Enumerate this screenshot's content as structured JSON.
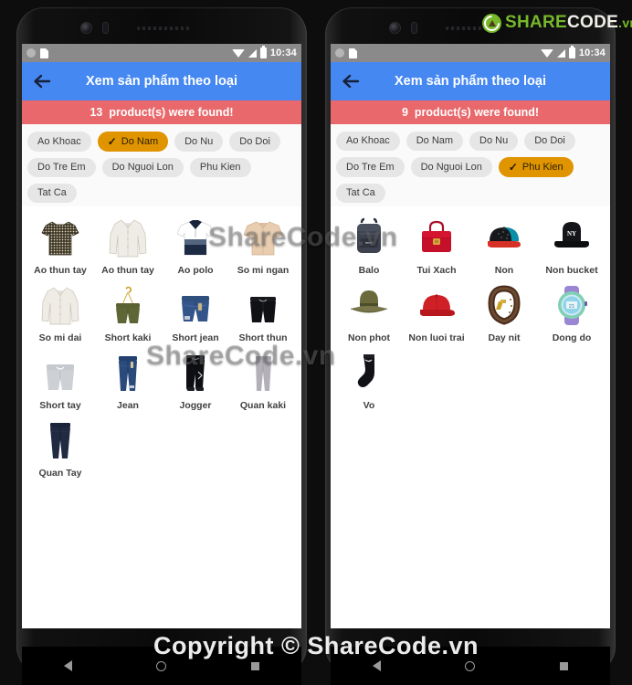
{
  "watermark": {
    "overlay_1": "ShareCode.vn",
    "overlay_2": "ShareCode.vn",
    "bottom": "Copyright © ShareCode.vn",
    "logo_share": "SHARE",
    "logo_code": "CODE",
    "logo_vn": ".vn"
  },
  "colors": {
    "appbar": "#4688f1",
    "banner": "#e9686b",
    "chip_bg": "#e6e6e6",
    "chip_selected": "#e09400",
    "statusbar": "#8a8a8a",
    "brand_green": "#76b82a"
  },
  "phones": [
    {
      "status_bar": {
        "time": "10:34",
        "icons": [
          "circle-icon",
          "sd-card-icon",
          "wifi-icon",
          "signal-icon",
          "battery-icon"
        ]
      },
      "appbar": {
        "title": "Xem sản phẩm theo loại",
        "back_icon": "back-arrow-icon"
      },
      "banner": {
        "count": "13",
        "text": "product(s) were found!"
      },
      "chips": [
        {
          "label": "Ao Khoac",
          "selected": false
        },
        {
          "label": "Do Nam",
          "selected": true
        },
        {
          "label": "Do Nu",
          "selected": false
        },
        {
          "label": "Do Doi",
          "selected": false
        },
        {
          "label": "Do Tre Em",
          "selected": false
        },
        {
          "label": "Do Nguoi Lon",
          "selected": false
        },
        {
          "label": "Phu Kien",
          "selected": false
        },
        {
          "label": "Tat Ca",
          "selected": false
        }
      ],
      "products": [
        {
          "label": "Ao thun tay",
          "icon": "tshirt-patterned"
        },
        {
          "label": "Ao thun tay",
          "icon": "shirt-long-white"
        },
        {
          "label": "Ao polo",
          "icon": "polo-navy"
        },
        {
          "label": "So mi ngan",
          "icon": "shirt-short-beige"
        },
        {
          "label": "So mi dai",
          "icon": "shirt-long-white"
        },
        {
          "label": "Short kaki",
          "icon": "shorts-olive"
        },
        {
          "label": "Short jean",
          "icon": "shorts-denim"
        },
        {
          "label": "Short thun",
          "icon": "shorts-black"
        },
        {
          "label": "Short tay",
          "icon": "shorts-grey"
        },
        {
          "label": "Jean",
          "icon": "jeans-blue"
        },
        {
          "label": "Jogger",
          "icon": "jogger-black"
        },
        {
          "label": "Quan kaki",
          "icon": "pants-grey"
        },
        {
          "label": "Quan Tay",
          "icon": "pants-navy"
        }
      ],
      "nav": {
        "back": "nav-back-icon",
        "home": "nav-home-icon",
        "recents": "nav-recents-icon"
      }
    },
    {
      "status_bar": {
        "time": "10:34",
        "icons": [
          "circle-icon",
          "sd-card-icon",
          "wifi-icon",
          "signal-icon",
          "battery-icon"
        ]
      },
      "appbar": {
        "title": "Xem sản phẩm theo loại",
        "back_icon": "back-arrow-icon"
      },
      "banner": {
        "count": "9",
        "text": "product(s) were found!"
      },
      "chips": [
        {
          "label": "Ao Khoac",
          "selected": false
        },
        {
          "label": "Do Nam",
          "selected": false
        },
        {
          "label": "Do Nu",
          "selected": false
        },
        {
          "label": "Do Doi",
          "selected": false
        },
        {
          "label": "Do Tre Em",
          "selected": false
        },
        {
          "label": "Do Nguoi Lon",
          "selected": false
        },
        {
          "label": "Phu Kien",
          "selected": true
        },
        {
          "label": "Tat Ca",
          "selected": false
        }
      ],
      "products": [
        {
          "label": "Balo",
          "icon": "backpack-grey"
        },
        {
          "label": "Tui Xach",
          "icon": "handbag-red"
        },
        {
          "label": "Non",
          "icon": "snapback-cap"
        },
        {
          "label": "Non bucket",
          "icon": "bucket-hat-black"
        },
        {
          "label": "Non phot",
          "icon": "fedora-olive"
        },
        {
          "label": "Non luoi trai",
          "icon": "cap-red"
        },
        {
          "label": "Day nit",
          "icon": "belt-brown"
        },
        {
          "label": "Dong do",
          "icon": "smartwatch-green"
        },
        {
          "label": "Vo",
          "icon": "sock-black"
        }
      ],
      "nav": {
        "back": "nav-back-icon",
        "home": "nav-home-icon",
        "recents": "nav-recents-icon"
      }
    }
  ]
}
